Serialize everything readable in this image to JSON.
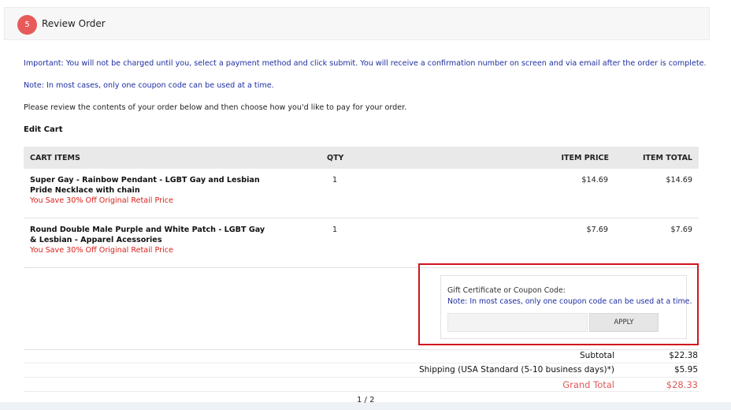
{
  "step": {
    "number": "5",
    "title": "Review Order"
  },
  "messages": {
    "important": "Important: You will not be charged until you, select a payment method and click submit. You will receive a confirmation number on screen and via email after the order is complete.",
    "note": "Note: In most cases, only one coupon code can be used at a time.",
    "review": "Please review the contents of your order below and then choose how you'd like to pay for your order."
  },
  "edit_cart": "Edit Cart",
  "cart": {
    "headers": [
      "CART ITEMS",
      "QTY",
      "ITEM PRICE",
      "ITEM TOTAL"
    ],
    "items": [
      {
        "name": "Super Gay - Rainbow Pendant - LGBT Gay and Lesbian Pride Necklace with chain",
        "savings": "You Save 30% Off Original Retail Price",
        "qty": "1",
        "price": "$14.69",
        "total": "$14.69"
      },
      {
        "name": "Round Double Male Purple and White Patch - LGBT Gay & Lesbian - Apparel Acessories",
        "savings": "You Save 30% Off Original Retail Price",
        "qty": "1",
        "price": "$7.69",
        "total": "$7.69"
      }
    ]
  },
  "coupon": {
    "label": "Gift Certificate or Coupon Code:",
    "note": "Note: In most cases, only one coupon code can be used at a time.",
    "input_value": "",
    "apply_label": "APPLY"
  },
  "totals": {
    "subtotal_label": "Subtotal",
    "subtotal": "$22.38",
    "shipping_label": "Shipping (USA Standard (5-10 business days)*)",
    "shipping": "$5.95",
    "grand_label": "Grand Total",
    "grand": "$28.33"
  },
  "pager": "1 / 2",
  "colors": {
    "badge": "#e85a5a",
    "highlight_frame": "#d0141c",
    "savings": "#d9211b",
    "note": "#1f2fa0",
    "grand_total": "#e05858"
  }
}
